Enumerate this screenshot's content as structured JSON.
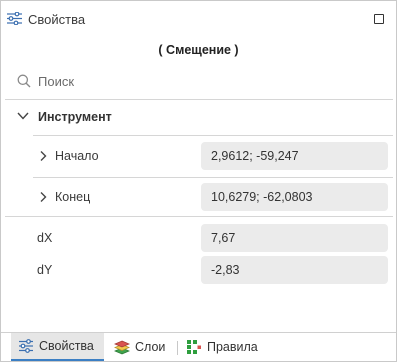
{
  "panel": {
    "title": "Свойства",
    "title_icon": "sliders-icon",
    "maximize_icon": "maximize-icon"
  },
  "subtitle": "( Смещение )",
  "search": {
    "placeholder": "Поиск",
    "value": ""
  },
  "group": {
    "title": "Инструмент",
    "expanded": true,
    "rows": [
      {
        "label": "Начало",
        "value": "2,9612; -59,247",
        "expandable": true
      },
      {
        "label": "Конец",
        "value": "10,6279; -62,0803",
        "expandable": true
      },
      {
        "label": "dX",
        "value": "7,67",
        "expandable": false
      },
      {
        "label": "dY",
        "value": "-2,83",
        "expandable": false
      }
    ]
  },
  "tabs": [
    {
      "label": "Свойства",
      "icon": "sliders-icon",
      "active": true
    },
    {
      "label": "Слои",
      "icon": "layers-icon",
      "active": false
    },
    {
      "label": "Правила",
      "icon": "rules-icon",
      "active": false
    }
  ],
  "colors": {
    "accent": "#3b7fc4",
    "layers_red": "#d9534f",
    "layers_green": "#3fa34d",
    "rules_green": "#2e9e3e"
  }
}
